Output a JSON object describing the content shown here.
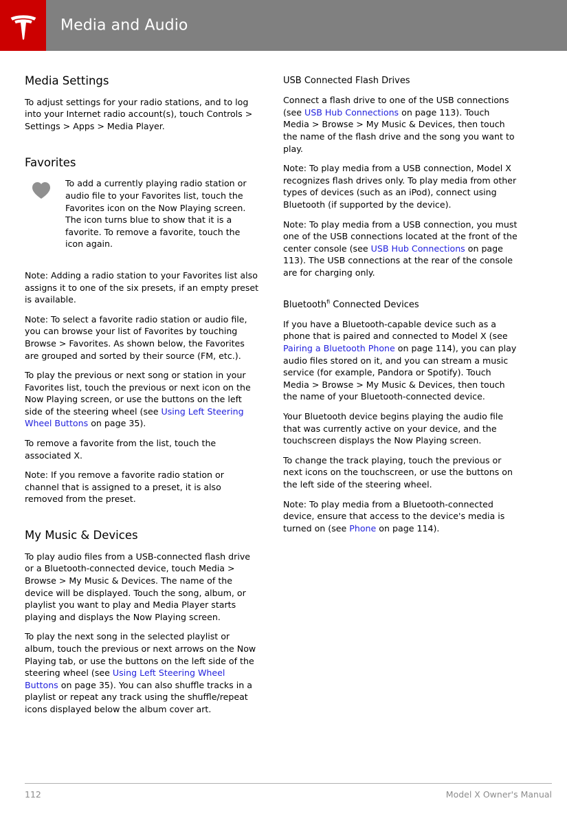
{
  "header": {
    "title": "Media and Audio",
    "logo_icon": "tesla-logo-icon",
    "logo_bg_color": "#cc0000",
    "bar_bg_color": "#808080"
  },
  "left_column": {
    "media_settings": {
      "heading": "Media Settings",
      "paragraph": "To adjust settings for your radio stations, and to log into your Internet radio account(s), touch Controls > Settings > Apps > Media Player."
    },
    "favorites": {
      "heading": "Favorites",
      "callout_icon": "heart-plus-favorites-icon",
      "callout_text": "To add a currently playing radio station or audio file to your Favorites list, touch the Favorites icon on the Now Playing screen. The icon turns blue to show that it is a favorite. To remove a favorite, touch the icon again.",
      "note_presets": "Note: Adding a radio station to your Favorites list also assigns it to one of the six presets, if an empty preset is available.",
      "note_browse": "Note: To select a favorite radio station or audio file, you can browse your list of Favorites by touching Browse > Favorites. As shown below, the Favorites are grouped and sorted by their source (FM, etc.).",
      "para_prev_next_a": "To play the previous or next song or station in your Favorites list, touch the previous or next icon on the Now Playing screen, or use the buttons on the left side of the steering wheel (see ",
      "para_prev_next_link": "Using Left Steering Wheel Buttons",
      "para_prev_next_b": " on page 35).",
      "para_remove": "To remove a favorite from the list, touch the associated X.",
      "note_preset_removal": "Note: If you remove a favorite radio station or channel that is assigned to a preset, it is also removed from the preset."
    },
    "my_music": {
      "heading": "My Music & Devices",
      "para_usb_bt": "To play audio files from a USB-connected flash drive or a Bluetooth-connected device, touch Media > Browse > My Music & Devices. The name of the device will be displayed. Touch the song, album, or playlist you want to play and Media Player starts playing and displays the Now Playing screen.",
      "para_next_song_a": "To play the next song in the selected playlist or album, touch the previous or next arrows on the Now Playing tab, or use the buttons on the left side of the steering wheel (see ",
      "para_next_song_link": "Using Left Steering Wheel Buttons",
      "para_next_song_b": " on page 35). You can also shuffle tracks in a playlist or repeat any track using the shuffle/repeat icons displayed below the album cover art."
    }
  },
  "right_column": {
    "usb_flash": {
      "heading": "USB Connected Flash Drives",
      "para_connect_a": "Connect a flash drive to one of the USB connections (see ",
      "para_connect_link": "USB Hub Connections",
      "para_connect_b": " on page 113). Touch Media > Browse > My Music & Devices, then touch the name of the flash drive and the song you want to play.",
      "note_flash_only": "Note: To play media from a USB connection, Model X recognizes flash drives only. To play media from other types of devices (such as an iPod), connect using Bluetooth (if supported by the device).",
      "note_front_console_a": "Note: To play media from a USB connection, you must one of the USB connections located at the front of the center console (see ",
      "note_front_console_link": "USB Hub Connections",
      "note_front_console_b": " on page 113). The USB connections at the rear of the console are for charging only."
    },
    "bluetooth": {
      "heading_main": "Bluetooth",
      "heading_sup": "fi",
      "heading_rest": " Connected Devices",
      "para_capable_a": "If you have a Bluetooth-capable device such as a phone that is paired and connected to Model X (see ",
      "para_capable_link": "Pairing a Bluetooth Phone",
      "para_capable_b": " on page 114), you can play audio files stored on it, and you can stream a music service (for example, Pandora or Spotify). Touch Media > Browse > My Music & Devices, then touch the name of your Bluetooth-connected device.",
      "para_begins_playing": "Your Bluetooth device begins playing the audio file that was currently active on your device, and the touchscreen displays the Now Playing screen.",
      "para_change_track": "To change the track playing, touch the previous or next icons on the touchscreen, or use the buttons on the left side of the steering wheel.",
      "note_access_a": "Note: To play media from a Bluetooth-connected device, ensure that access to the device's media is turned on (see ",
      "note_access_link": "Phone",
      "note_access_b": " on page 114)."
    }
  },
  "footer": {
    "page_number": "112",
    "manual_title": "Model X Owner's Manual"
  },
  "colors": {
    "link": "#2222dd",
    "footer_text": "#8c8c8c",
    "brand_red": "#cc0000",
    "header_gray": "#808080"
  }
}
